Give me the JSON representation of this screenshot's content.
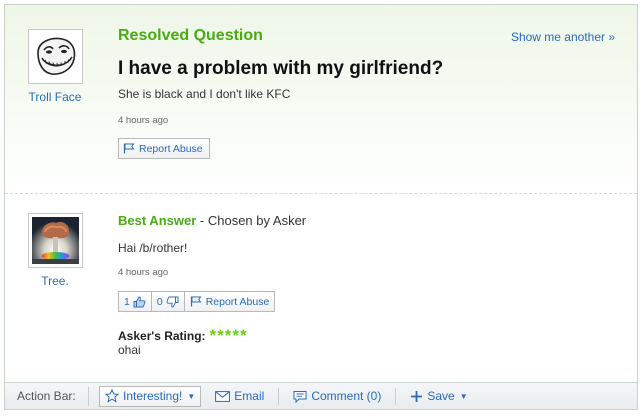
{
  "question": {
    "status": "Resolved Question",
    "show_another": "Show me another »",
    "title": "I have a problem with my girlfriend?",
    "body": "She is black and I don't like KFC",
    "time": "4 hours ago",
    "report_abuse": "Report Abuse",
    "asker": {
      "name": "Troll Face",
      "avatar_icon": "troll-face-avatar"
    }
  },
  "answer": {
    "best_answer_label": "Best Answer",
    "chosen_by": "- Chosen by Asker",
    "body": "Hai /b/rother!",
    "time": "4 hours ago",
    "thumbs_up_count": "1",
    "thumbs_down_count": "0",
    "report_abuse": "Report Abuse",
    "answerer": {
      "name": "Tree.",
      "avatar_icon": "nuclear-tree-avatar"
    },
    "rating_label": "Asker's Rating:",
    "rating_stars": "*****",
    "rating": 5,
    "rating_comment": "ohai"
  },
  "action_bar": {
    "label": "Action Bar:",
    "interesting": "Interesting!",
    "email": "Email",
    "comment": "Comment (0)",
    "save": "Save"
  },
  "colors": {
    "accent_green": "#4aab16",
    "link_blue": "#2b6ab8",
    "star_green": "#6fcc1e"
  }
}
